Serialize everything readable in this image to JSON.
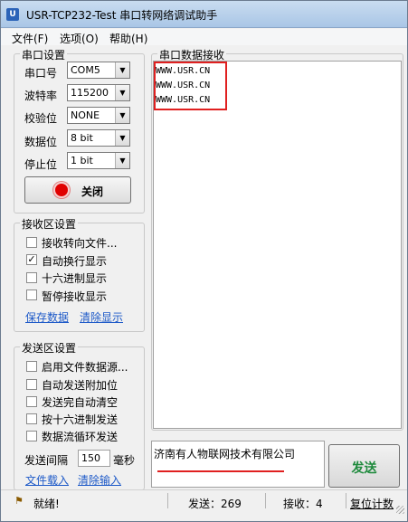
{
  "window": {
    "title": "USR-TCP232-Test 串口转网络调试助手"
  },
  "menu": {
    "items": [
      "文件(F)",
      "选项(O)",
      "帮助(H)"
    ]
  },
  "serial_settings": {
    "title": "串口设置",
    "port_label": "串口号",
    "port_value": "COM5",
    "baud_label": "波特率",
    "baud_value": "115200",
    "parity_label": "校验位",
    "parity_value": "NONE",
    "databits_label": "数据位",
    "databits_value": "8 bit",
    "stopbits_label": "停止位",
    "stopbits_value": "1 bit",
    "close_button": "关闭",
    "led_color": "#e00000"
  },
  "receive_settings": {
    "title": "接收区设置",
    "options": [
      {
        "label": "接收转向文件...",
        "checked": false
      },
      {
        "label": "自动换行显示",
        "checked": true
      },
      {
        "label": "十六进制显示",
        "checked": false
      },
      {
        "label": "暂停接收显示",
        "checked": false
      }
    ],
    "save_link": "保存数据",
    "clear_link": "清除显示"
  },
  "send_settings": {
    "title": "发送区设置",
    "options": [
      {
        "label": "启用文件数据源...",
        "checked": false
      },
      {
        "label": "自动发送附加位",
        "checked": false
      },
      {
        "label": "发送完自动清空",
        "checked": false
      },
      {
        "label": "按十六进制发送",
        "checked": false
      },
      {
        "label": "数据流循环发送",
        "checked": false
      }
    ],
    "interval_label": "发送间隔",
    "interval_value": "150",
    "interval_unit": "毫秒",
    "load_file_link": "文件载入",
    "clear_input_link": "清除输入"
  },
  "receive_area": {
    "title": "串口数据接收",
    "lines": [
      "WWW.USR.CN",
      "WWW.USR.CN",
      "WWW.USR.CN"
    ],
    "highlight_color": "#e02020"
  },
  "send_area": {
    "text": "济南有人物联网技术有限公司",
    "send_button": "发送",
    "send_button_color": "#1e8a3c",
    "underline_color": "#e02020"
  },
  "status": {
    "ready": "就绪!",
    "sent_label": "发送：269",
    "received_label": "接收：4",
    "reset_label": "复位计数"
  }
}
